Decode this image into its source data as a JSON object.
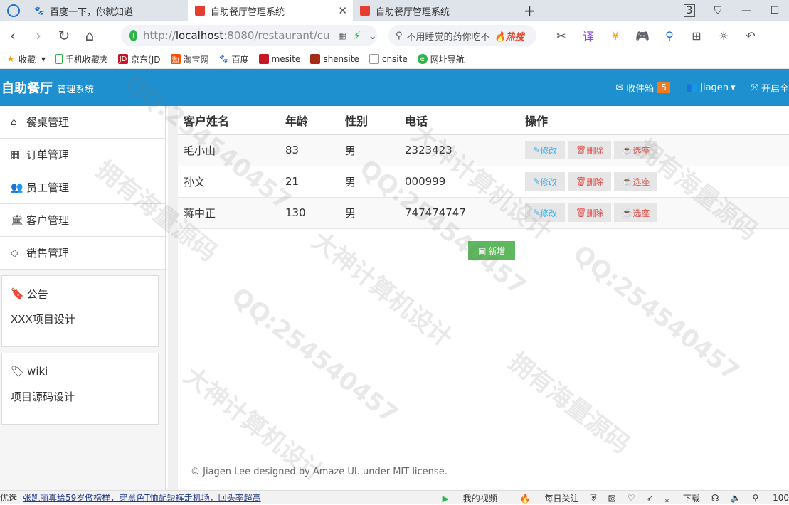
{
  "browser": {
    "tabs": [
      {
        "label": "百度一下，你就知道",
        "icon": "baidu-paw-icon"
      },
      {
        "label": "自助餐厅管理系统",
        "icon": "site-icon",
        "active": true
      },
      {
        "label": "自助餐厅管理系统",
        "icon": "site-icon"
      }
    ],
    "tab_count": "3",
    "url_prefix": "http://",
    "url_host": "localhost",
    "url_rest": ":8080/restaurant/cu",
    "search_placeholder": "不用睡觉的药你吃不",
    "search_hot": "热搜",
    "bookmarks": [
      "收藏",
      "手机收藏夹",
      "京东(JD",
      "淘宝网",
      "百度",
      "mesite",
      "shensite",
      "cnsite",
      "网址导航"
    ]
  },
  "header": {
    "brand": "自助餐厅",
    "brand_sub": "管理系统",
    "inbox_label": "收件箱",
    "inbox_count": "5",
    "user": "Jiagen",
    "fullscreen_label": "开启全"
  },
  "sidebar": {
    "items": [
      {
        "label": "餐桌管理",
        "icon": "home-icon"
      },
      {
        "label": "订单管理",
        "icon": "table-icon"
      },
      {
        "label": "员工管理",
        "icon": "users-icon"
      },
      {
        "label": "客户管理",
        "icon": "bank-icon"
      },
      {
        "label": "销售管理",
        "icon": "diamond-icon"
      }
    ],
    "notice_title": "公告",
    "notice_body": "XXX项目设计",
    "wiki_title": "wiki",
    "wiki_body": "项目源码设计"
  },
  "table": {
    "headers": [
      "客户姓名",
      "年龄",
      "性别",
      "电话",
      "操作"
    ],
    "rows": [
      {
        "name": "毛小山",
        "age": "83",
        "gender": "男",
        "phone": "2323423"
      },
      {
        "name": "孙文",
        "age": "21",
        "gender": "男",
        "phone": "000999"
      },
      {
        "name": "蒋中正",
        "age": "130",
        "gender": "男",
        "phone": "747474747"
      }
    ],
    "edit_label": "修改",
    "delete_label": "删除",
    "seat_label": "选座",
    "add_label": "新增"
  },
  "footer": "© Jiagen Lee designed by Amaze UI. under MIT license.",
  "statusbar": {
    "left": "优选",
    "news": "张凯丽真给59岁傲榜样，穿黑色T恤配短裤走机场，回头率超高",
    "video": "我的视频",
    "daily": "每日关注",
    "download": "下载",
    "zoom": "100"
  },
  "watermarks": [
    "QQ:254540457",
    "大神计算机设计",
    "拥有海量源码"
  ]
}
